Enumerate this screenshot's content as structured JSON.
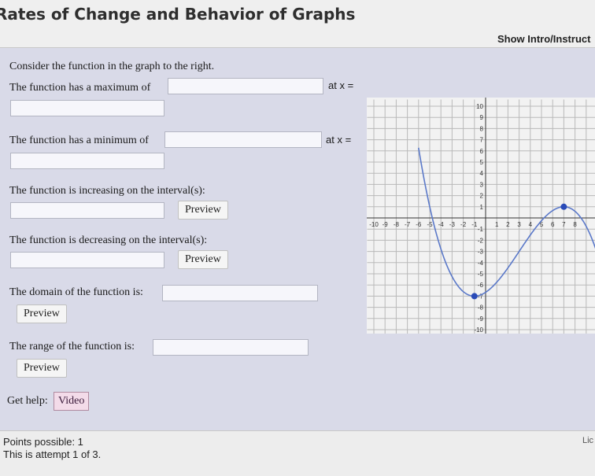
{
  "header": {
    "title": "Rates of Change and Behavior of Graphs",
    "intro_link": "Show Intro/Instruct"
  },
  "question": {
    "intro": "Consider the function in the graph to the right.",
    "max_label": "The function has a maximum of",
    "min_label": "The function has a minimum of",
    "at_x": "at x =",
    "increasing_label": "The function is increasing on the interval(s):",
    "decreasing_label": "The function is decreasing on the interval(s):",
    "domain_label": "The domain of the function is:",
    "range_label": "The range of the function is:",
    "preview": "Preview",
    "help_label": "Get help:",
    "video": "Video"
  },
  "footer": {
    "points": "Points possible: 1",
    "attempt": "This is attempt 1 of 3.",
    "license": "Lic"
  },
  "graph": {
    "x_ticks": [
      "-10",
      "-9",
      "-8",
      "-7",
      "-6",
      "-5",
      "-4",
      "-3",
      "-2",
      "-1",
      "1",
      "2",
      "3",
      "4",
      "5",
      "6",
      "7",
      "8"
    ],
    "y_ticks_pos": [
      "10",
      "9",
      "8",
      "7",
      "6",
      "5",
      "4",
      "3",
      "2",
      "1"
    ],
    "y_ticks_neg": [
      "-1",
      "-2",
      "-3",
      "-4",
      "-5",
      "-6",
      "-7",
      "-8",
      "-9",
      "-10"
    ],
    "curve_color": "#5b79c9",
    "point_color": "#2a4bb8",
    "min_point": {
      "x": -1,
      "y": -7
    },
    "max_point": {
      "x": 7,
      "y": 1
    }
  }
}
